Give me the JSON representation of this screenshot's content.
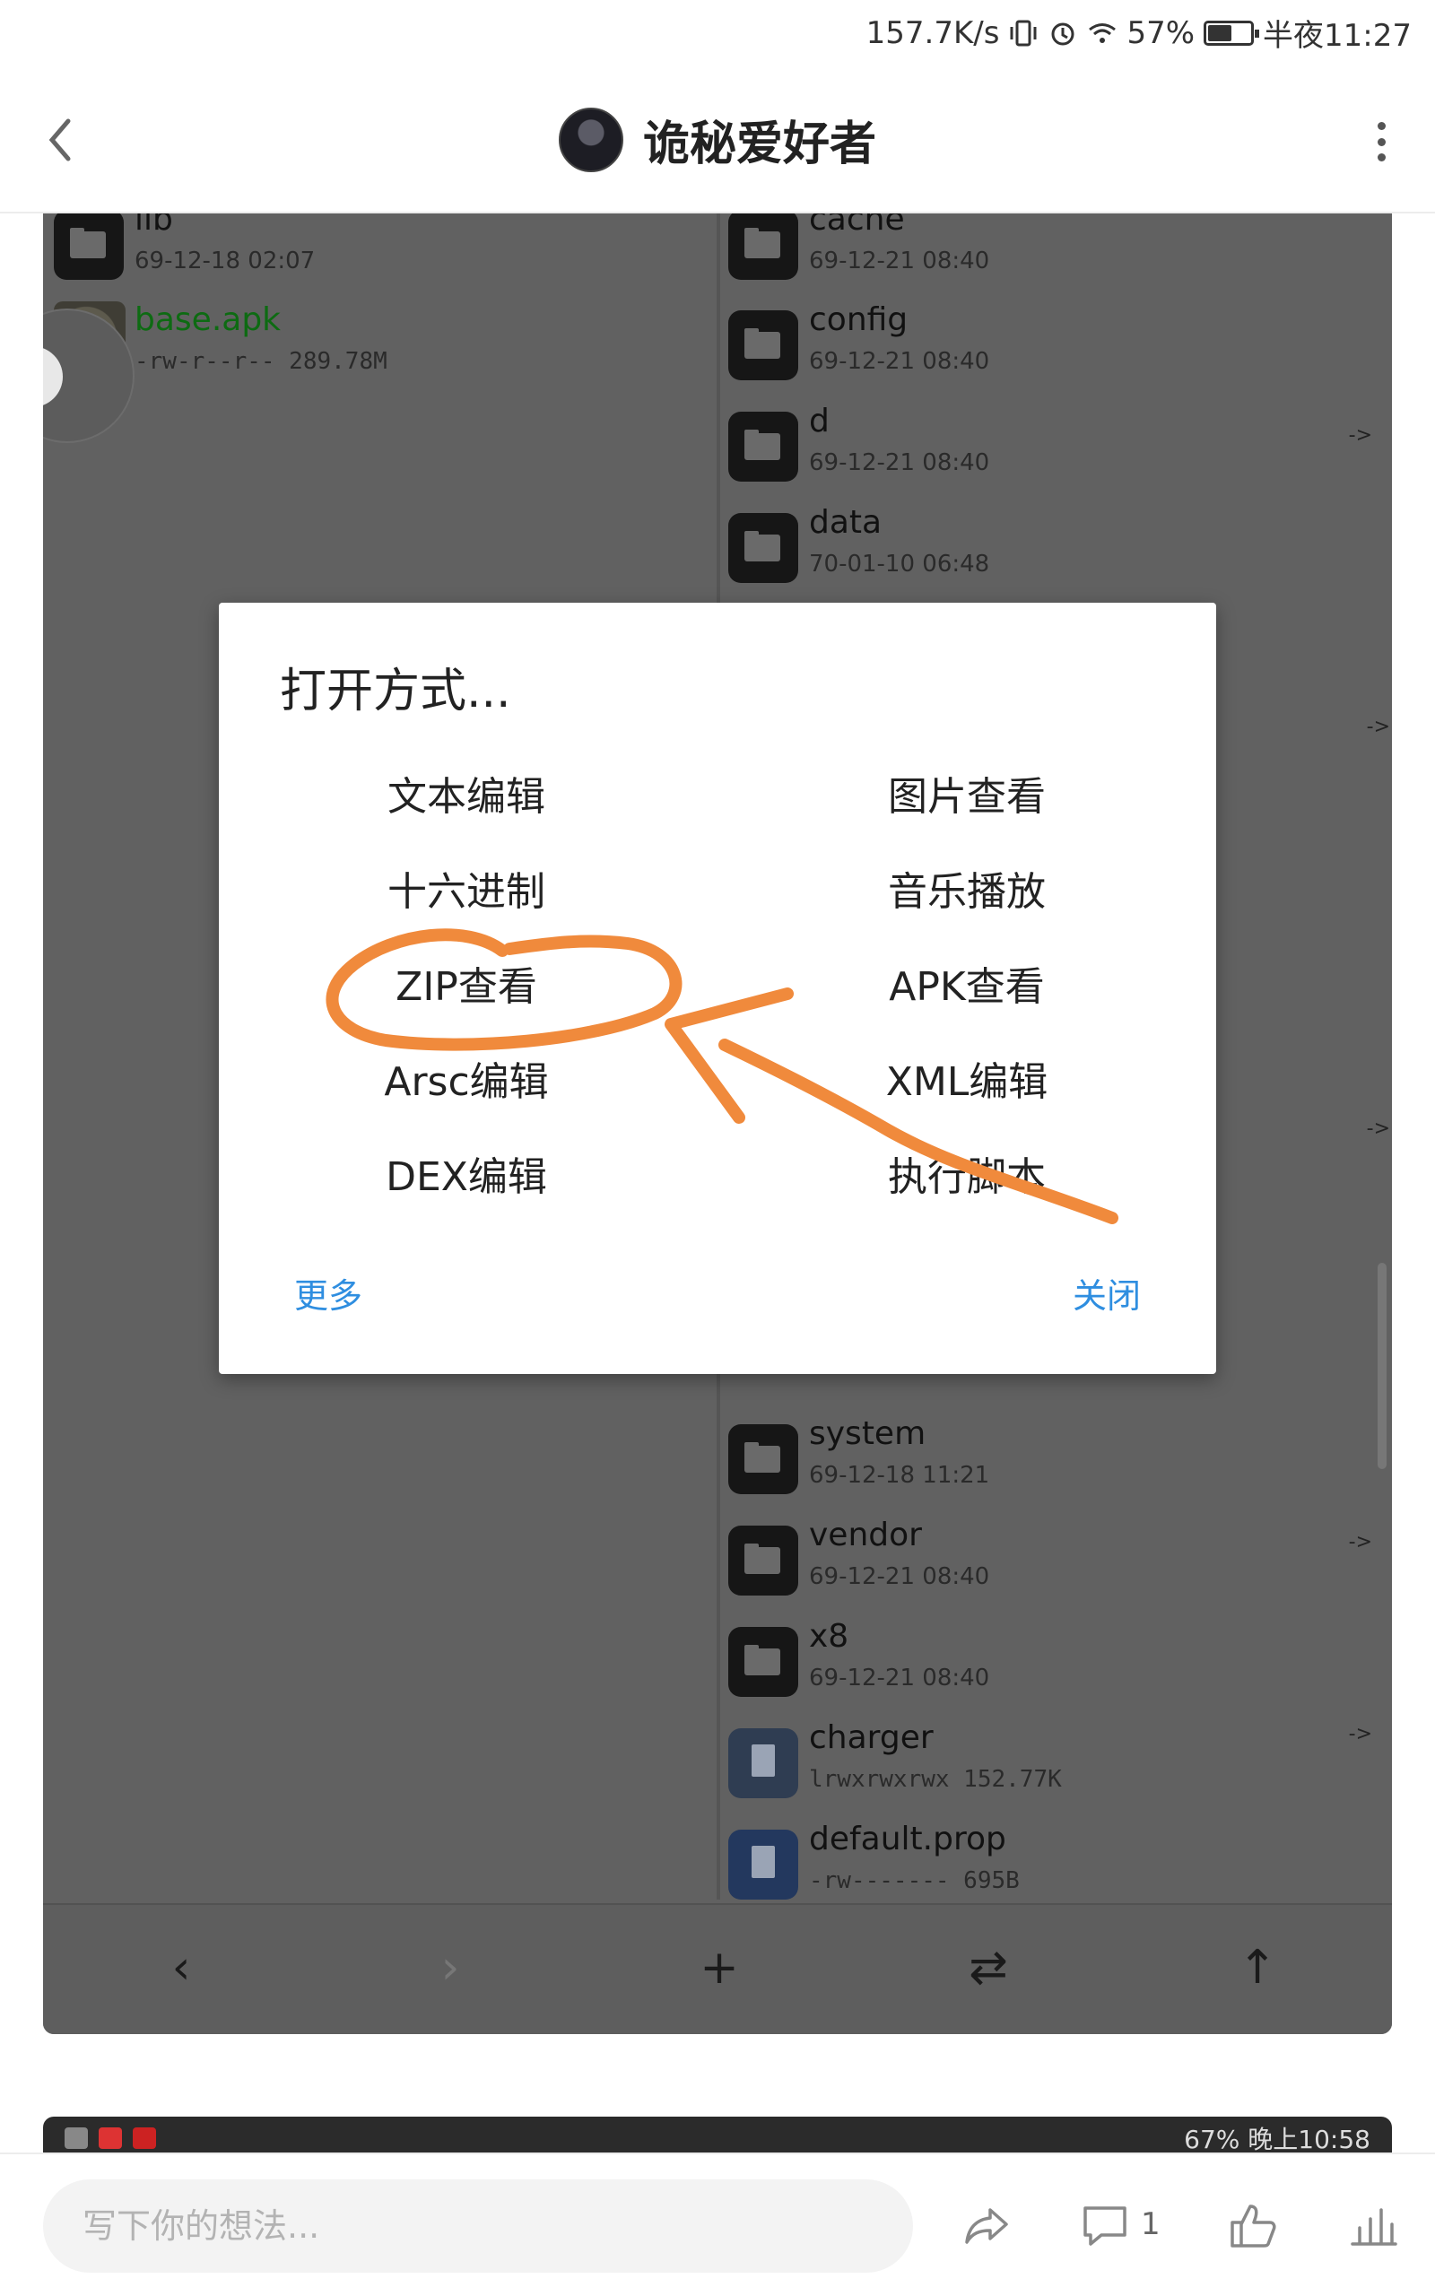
{
  "status_bar": {
    "net_speed": "157.7K/s",
    "battery": "57%",
    "battery_level": 0.57,
    "time": "半夜11:27"
  },
  "header": {
    "title": "诡秘爱好者",
    "back_icon": "chevron-left-icon",
    "more_icon": "vertical-dots-icon"
  },
  "file_manager": {
    "left_pane": [
      {
        "name": "lib",
        "meta": "69-12-18 02:07",
        "type": "folder"
      },
      {
        "name": "base.apk",
        "meta": "-rw-r--r--  289.78M",
        "type": "apk"
      }
    ],
    "right_pane": [
      {
        "name": "cache",
        "meta": "69-12-21 08:40",
        "type": "folder"
      },
      {
        "name": "config",
        "meta": "69-12-21 08:40",
        "type": "folder"
      },
      {
        "name": "d",
        "meta": "69-12-21 08:40",
        "type": "folder"
      },
      {
        "name": "data",
        "meta": "70-01-10 06:48",
        "type": "folder"
      },
      {
        "name": "system",
        "meta": "69-12-18 11:21",
        "type": "folder"
      },
      {
        "name": "vendor",
        "meta": "69-12-21 08:40",
        "type": "folder"
      },
      {
        "name": "x8",
        "meta": "69-12-21 08:40",
        "type": "folder"
      },
      {
        "name": "charger",
        "meta": "lrwxrwxrwx  152.77K",
        "type": "file"
      },
      {
        "name": "default.prop",
        "meta": "-rw-------  695B",
        "type": "doc"
      }
    ],
    "link_arrow": "->",
    "toolbar": {
      "back": "‹",
      "forward": "›",
      "add": "+",
      "swap": "⇄",
      "up": "↑"
    }
  },
  "dialog": {
    "title": "打开方式...",
    "options": [
      [
        "文本编辑",
        "图片查看"
      ],
      [
        "十六进制",
        "音乐播放"
      ],
      [
        "ZIP查看",
        "APK查看"
      ],
      [
        "Arsc编辑",
        "XML编辑"
      ],
      [
        "DEX编辑",
        "执行脚本"
      ]
    ],
    "more_label": "更多",
    "close_label": "关闭"
  },
  "annotation_color": "#f08a3c",
  "peek_status": {
    "right_text": "67%  晚上10:58"
  },
  "comment_bar": {
    "placeholder": "写下你的想法...",
    "comment_count": "1"
  }
}
